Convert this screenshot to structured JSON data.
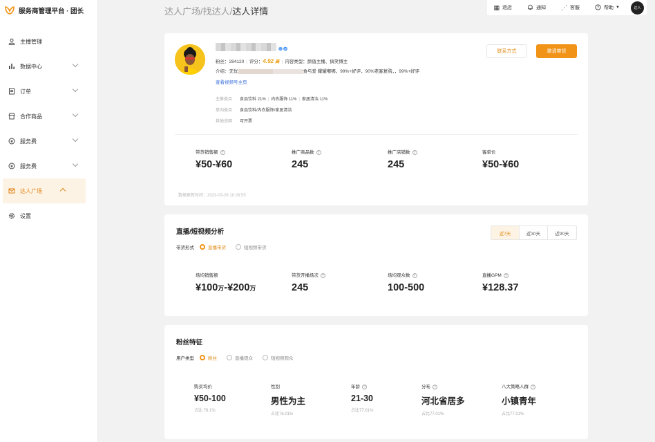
{
  "app": {
    "title": "服务商管理平台 · 团长",
    "brand_color": "#f19316"
  },
  "sidebar": {
    "items": [
      {
        "label": "主播管理",
        "icon": "user-icon"
      },
      {
        "label": "数据中心",
        "icon": "bar-chart-icon",
        "expandable": true
      },
      {
        "label": "订单",
        "icon": "document-icon",
        "expandable": true
      },
      {
        "label": "合作商品",
        "icon": "shop-icon",
        "expandable": true
      },
      {
        "label": "服务费",
        "icon": "coin-icon",
        "expandable": true
      },
      {
        "label": "服务费",
        "icon": "coin-icon",
        "expandable": true
      },
      {
        "label": "达人广场",
        "icon": "mail-icon",
        "expandable": true,
        "active": true
      },
      {
        "label": "设置",
        "icon": "gear-icon"
      }
    ]
  },
  "breadcrumb": {
    "part1": "达人广场",
    "sep1": "/",
    "part2": "找达人",
    "sep2": "/",
    "current": "达人详情"
  },
  "toolbar": {
    "switch": "退店",
    "notice": "通知",
    "service": "客服",
    "help": "帮助",
    "avatar_text": "达人"
  },
  "profile": {
    "fans_label": "粉丝：",
    "fans": "284120",
    "score_label": "评分：",
    "score": "4.92",
    "score_unit": "高",
    "content_label": "内容类型：",
    "content": "颜值主播、搞笑博主",
    "intro_label": "介绍：",
    "intro_a": "无忧",
    "intro_b": "食与爱 耀耀嘟嘟，99%+好评，90%老客复购，，99%+好评",
    "link": "查看视频号主页",
    "main_cat_label": "主推类目",
    "main_cat_1": "食品饮料 21%",
    "main_cat_2": "内衣服饰 11%",
    "main_cat_3": "家居清洁 11%",
    "intent_cat_label": "意向类目",
    "intent_cat": "食品饮料/内衣服饰/家居清洁",
    "other_label": "其他说明",
    "other": "可开票",
    "contact_btn": "联系方式",
    "invite_btn": "邀请带货"
  },
  "overview": {
    "metrics": [
      {
        "label": "带货销售额",
        "value": "¥50-¥60"
      },
      {
        "label": "推广商品数",
        "value": "245"
      },
      {
        "label": "推广店铺数",
        "value": "245"
      },
      {
        "label": "客单价",
        "value": "¥50-¥60"
      }
    ],
    "updated": "数据更新时间：2023-03-26 10:26:55"
  },
  "live": {
    "title": "直播/短视频分析",
    "range_tabs": [
      "近7天",
      "近30天",
      "近90天"
    ],
    "range_active": 0,
    "mode_label": "带货形式",
    "modes": [
      "直播带货",
      "短视频带货"
    ],
    "mode_active": 0,
    "metrics": [
      {
        "label": "场均销售额",
        "v1": "¥100",
        "u1": "万",
        "dash": "-",
        "v2": "¥200",
        "u2": "万"
      },
      {
        "label": "带货开播场次",
        "value": "245"
      },
      {
        "label": "场均观众数",
        "value": "100-500"
      },
      {
        "label": "直播GPM",
        "value": "¥128.37"
      }
    ]
  },
  "fans": {
    "title": "粉丝特征",
    "type_label": "用户类型",
    "types": [
      "粉丝",
      "直播观众",
      "短视频观众"
    ],
    "type_active": 0,
    "metrics": [
      {
        "label": "购买均价",
        "value": "¥50-100",
        "sub": "占比 78.1%"
      },
      {
        "label": "性别",
        "value": "男性为主",
        "sub": "占比76.01%"
      },
      {
        "label": "年龄",
        "value": "21-30",
        "sub": "占比77.01%"
      },
      {
        "label": "分布",
        "value": "河北省居多",
        "sub": "占比77.01%"
      },
      {
        "label": "八大策略人群",
        "value": "小镇青年",
        "sub": "占比77.01%"
      }
    ]
  }
}
